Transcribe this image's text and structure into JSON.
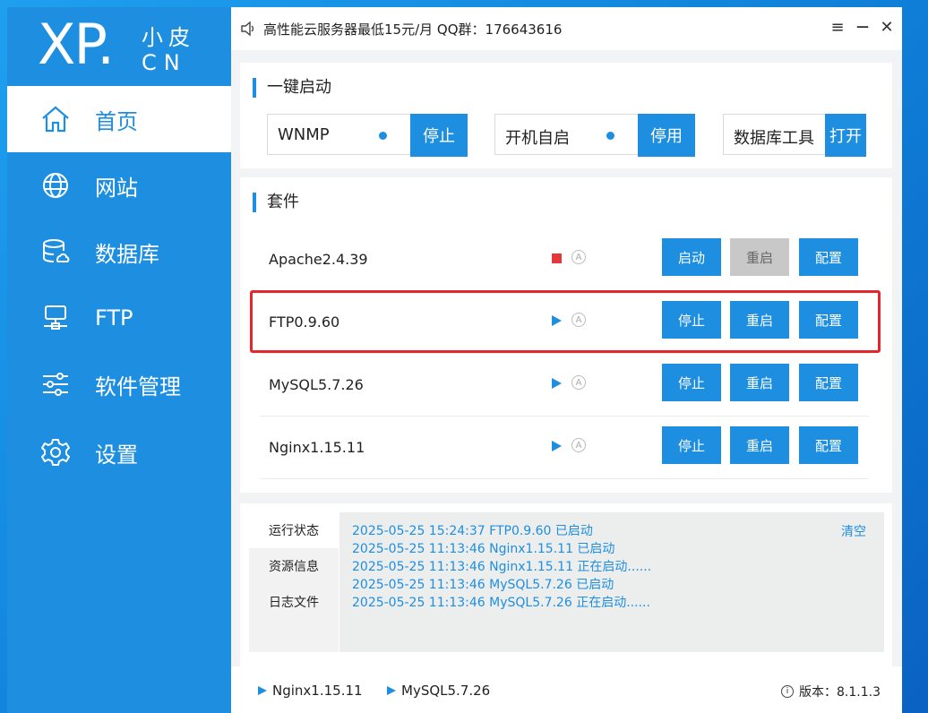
{
  "logo": {
    "xp": "XP.",
    "cn_top": "小皮",
    "cn_bottom": "CN"
  },
  "sidebar": {
    "items": [
      {
        "label": "首页",
        "icon": "home-icon",
        "active": true
      },
      {
        "label": "网站",
        "icon": "globe-icon",
        "active": false
      },
      {
        "label": "数据库",
        "icon": "database-icon",
        "active": false
      },
      {
        "label": "FTP",
        "icon": "ftp-icon",
        "active": false
      },
      {
        "label": "软件管理",
        "icon": "sliders-icon",
        "active": false
      },
      {
        "label": "设置",
        "icon": "gear-icon",
        "active": false
      }
    ]
  },
  "titlebar": {
    "notice": "高性能云服务器最低15元/月  QQ群：176643616",
    "menu_icon": "≡",
    "minimize_icon": "—",
    "close_icon": "✕"
  },
  "quick_start": {
    "title": "一键启动",
    "items": [
      {
        "label": "WNMP",
        "status": "on",
        "button": "停止"
      },
      {
        "label": "开机自启",
        "status": "on",
        "button": "停用"
      },
      {
        "label": "数据库工具",
        "button": "打开"
      }
    ]
  },
  "suite": {
    "title": "套件",
    "services": [
      {
        "name": "Apache2.4.39",
        "state": "stopped",
        "auto": "A",
        "buttons": [
          "启动",
          "重启",
          "配置"
        ]
      },
      {
        "name": "FTP0.9.60",
        "state": "running",
        "auto": "A",
        "buttons": [
          "停止",
          "重启",
          "配置"
        ]
      },
      {
        "name": "MySQL5.7.26",
        "state": "running",
        "auto": "A",
        "buttons": [
          "停止",
          "重启",
          "配置"
        ]
      },
      {
        "name": "Nginx1.15.11",
        "state": "running",
        "auto": "A",
        "buttons": [
          "停止",
          "重启",
          "配置"
        ]
      }
    ]
  },
  "log": {
    "tabs": [
      "运行状态",
      "资源信息",
      "日志文件"
    ],
    "clear": "清空",
    "lines": [
      "2025-05-25 15:24:37 FTP0.9.60 已启动",
      "2025-05-25 11:13:46 Nginx1.15.11 已启动",
      "2025-05-25 11:13:46 Nginx1.15.11 正在启动......",
      "2025-05-25 11:13:46 MySQL5.7.26 已启动",
      "2025-05-25 11:13:46 MySQL5.7.26 正在启动......"
    ]
  },
  "footer": {
    "running": [
      "Nginx1.15.11",
      "MySQL5.7.26"
    ],
    "version_icon": "i",
    "version": "版本：8.1.1.3"
  },
  "colors": {
    "accent": "#1e8fe0",
    "stopped": "#e5383b",
    "highlight": "#e5262a"
  }
}
